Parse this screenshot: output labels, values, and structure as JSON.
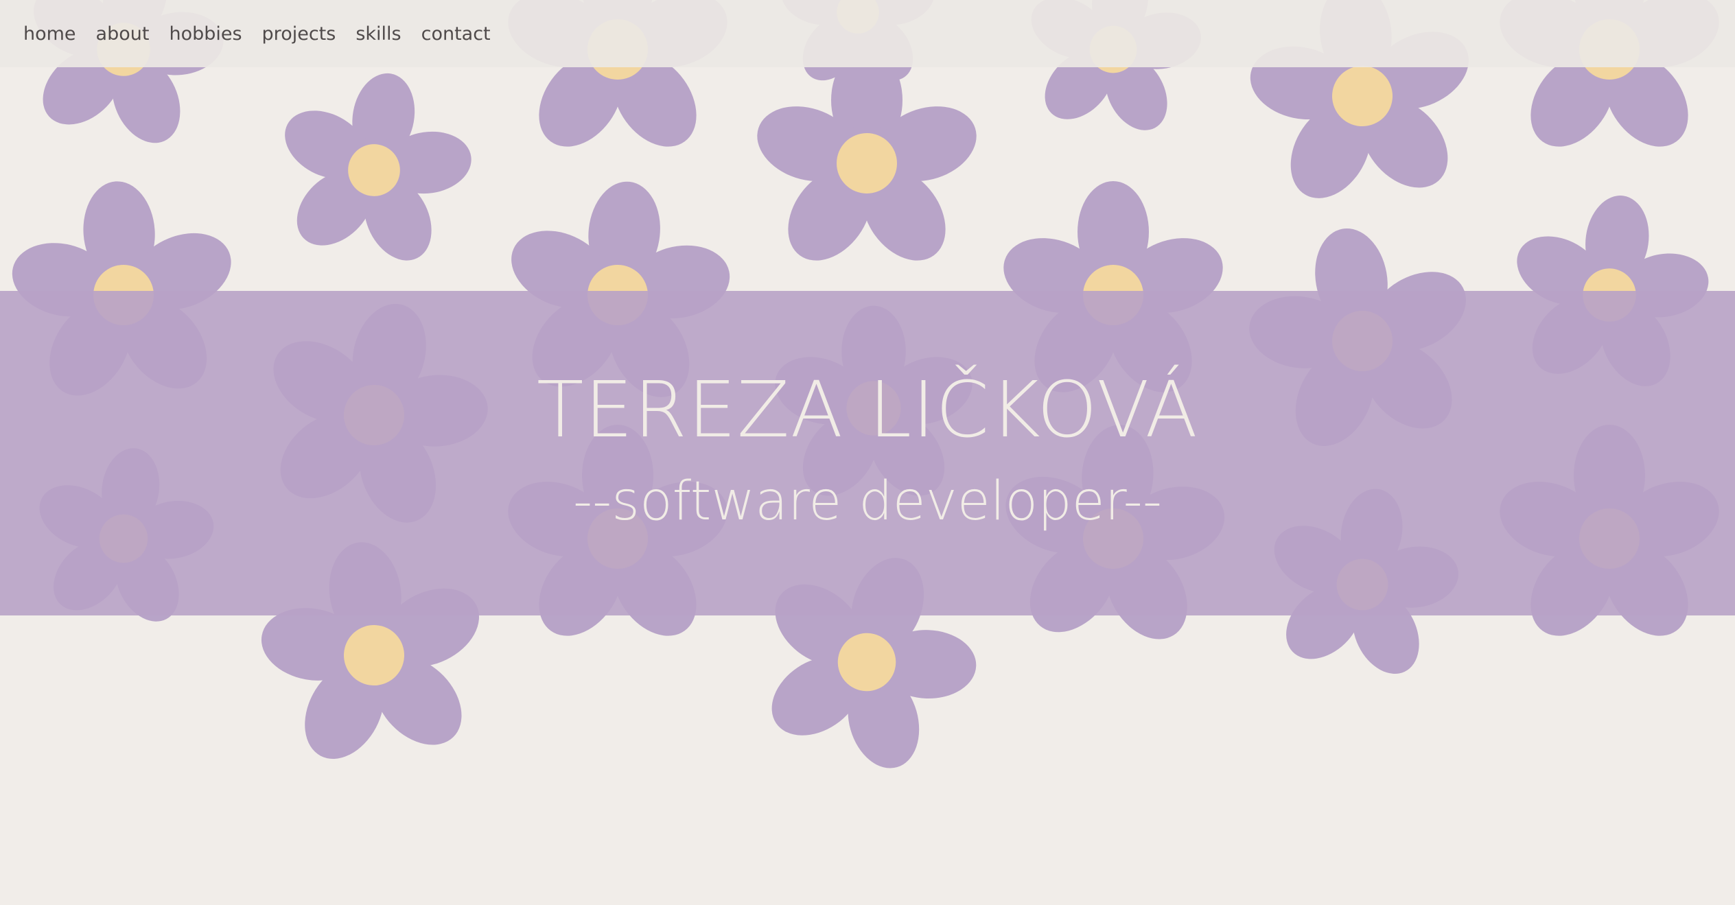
{
  "nav": {
    "items": [
      {
        "label": "home"
      },
      {
        "label": "about"
      },
      {
        "label": "hobbies"
      },
      {
        "label": "projects"
      },
      {
        "label": "skills"
      },
      {
        "label": "contact"
      }
    ]
  },
  "hero": {
    "title": "TEREZA LIČKOVÁ",
    "subtitle": "--software developer--"
  },
  "colors": {
    "background": "#f1ede9",
    "petal": "#b8a4c8",
    "center": "#f2d6a0",
    "band": "#bca9c8",
    "hero_text": "#f1ece6",
    "nav_text": "#4f4a4a"
  },
  "icons": {
    "background_pattern": "flower-icon"
  }
}
